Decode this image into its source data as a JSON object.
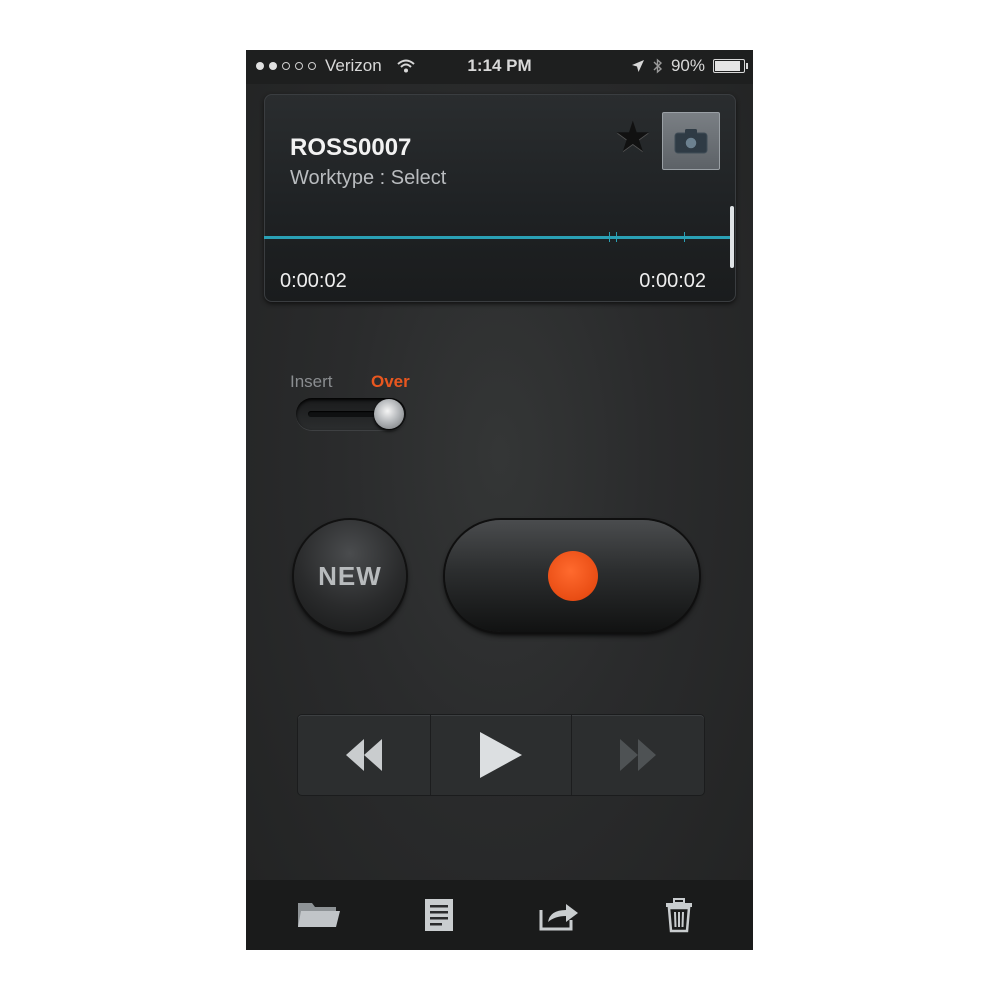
{
  "status_bar": {
    "carrier": "Verizon",
    "time": "1:14 PM",
    "battery": "90%",
    "battery_level": 0.9
  },
  "recording": {
    "name": "ROSS0007",
    "worktype": "Worktype : Select",
    "elapsed": "0:00:02",
    "total": "0:00:02"
  },
  "mode_toggle": {
    "insert_label": "Insert",
    "over_label": "Over",
    "selected": "Over"
  },
  "controls": {
    "new_label": "NEW"
  },
  "icons": {
    "star": "star-icon",
    "camera": "camera-icon",
    "record": "record-icon",
    "rewind": "rewind-icon",
    "play": "play-icon",
    "fast_forward": "fast-forward-icon",
    "folder": "folder-icon",
    "document": "document-icon",
    "share": "share-icon",
    "trash": "trash-icon"
  },
  "colors": {
    "accent": "#e9571f",
    "waveform": "#2aa0b5"
  }
}
